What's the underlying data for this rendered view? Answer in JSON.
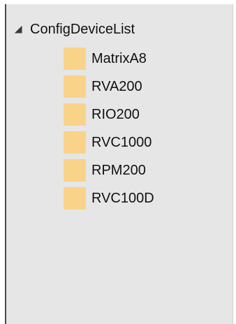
{
  "tree": {
    "root": {
      "label": "ConfigDeviceList",
      "expanded": true,
      "icon": "collapse-triangle-icon"
    },
    "children": [
      {
        "label": "MatrixA8",
        "icon": "folder-icon"
      },
      {
        "label": "RVA200",
        "icon": "folder-icon"
      },
      {
        "label": "RIO200",
        "icon": "folder-icon"
      },
      {
        "label": "RVC1000",
        "icon": "folder-icon"
      },
      {
        "label": "RPM200",
        "icon": "folder-icon"
      },
      {
        "label": "RVC100D",
        "icon": "folder-icon"
      }
    ]
  },
  "colors": {
    "panel_background": "#e6e6e6",
    "folder_icon": "#f9d38a",
    "text": "#111111"
  }
}
